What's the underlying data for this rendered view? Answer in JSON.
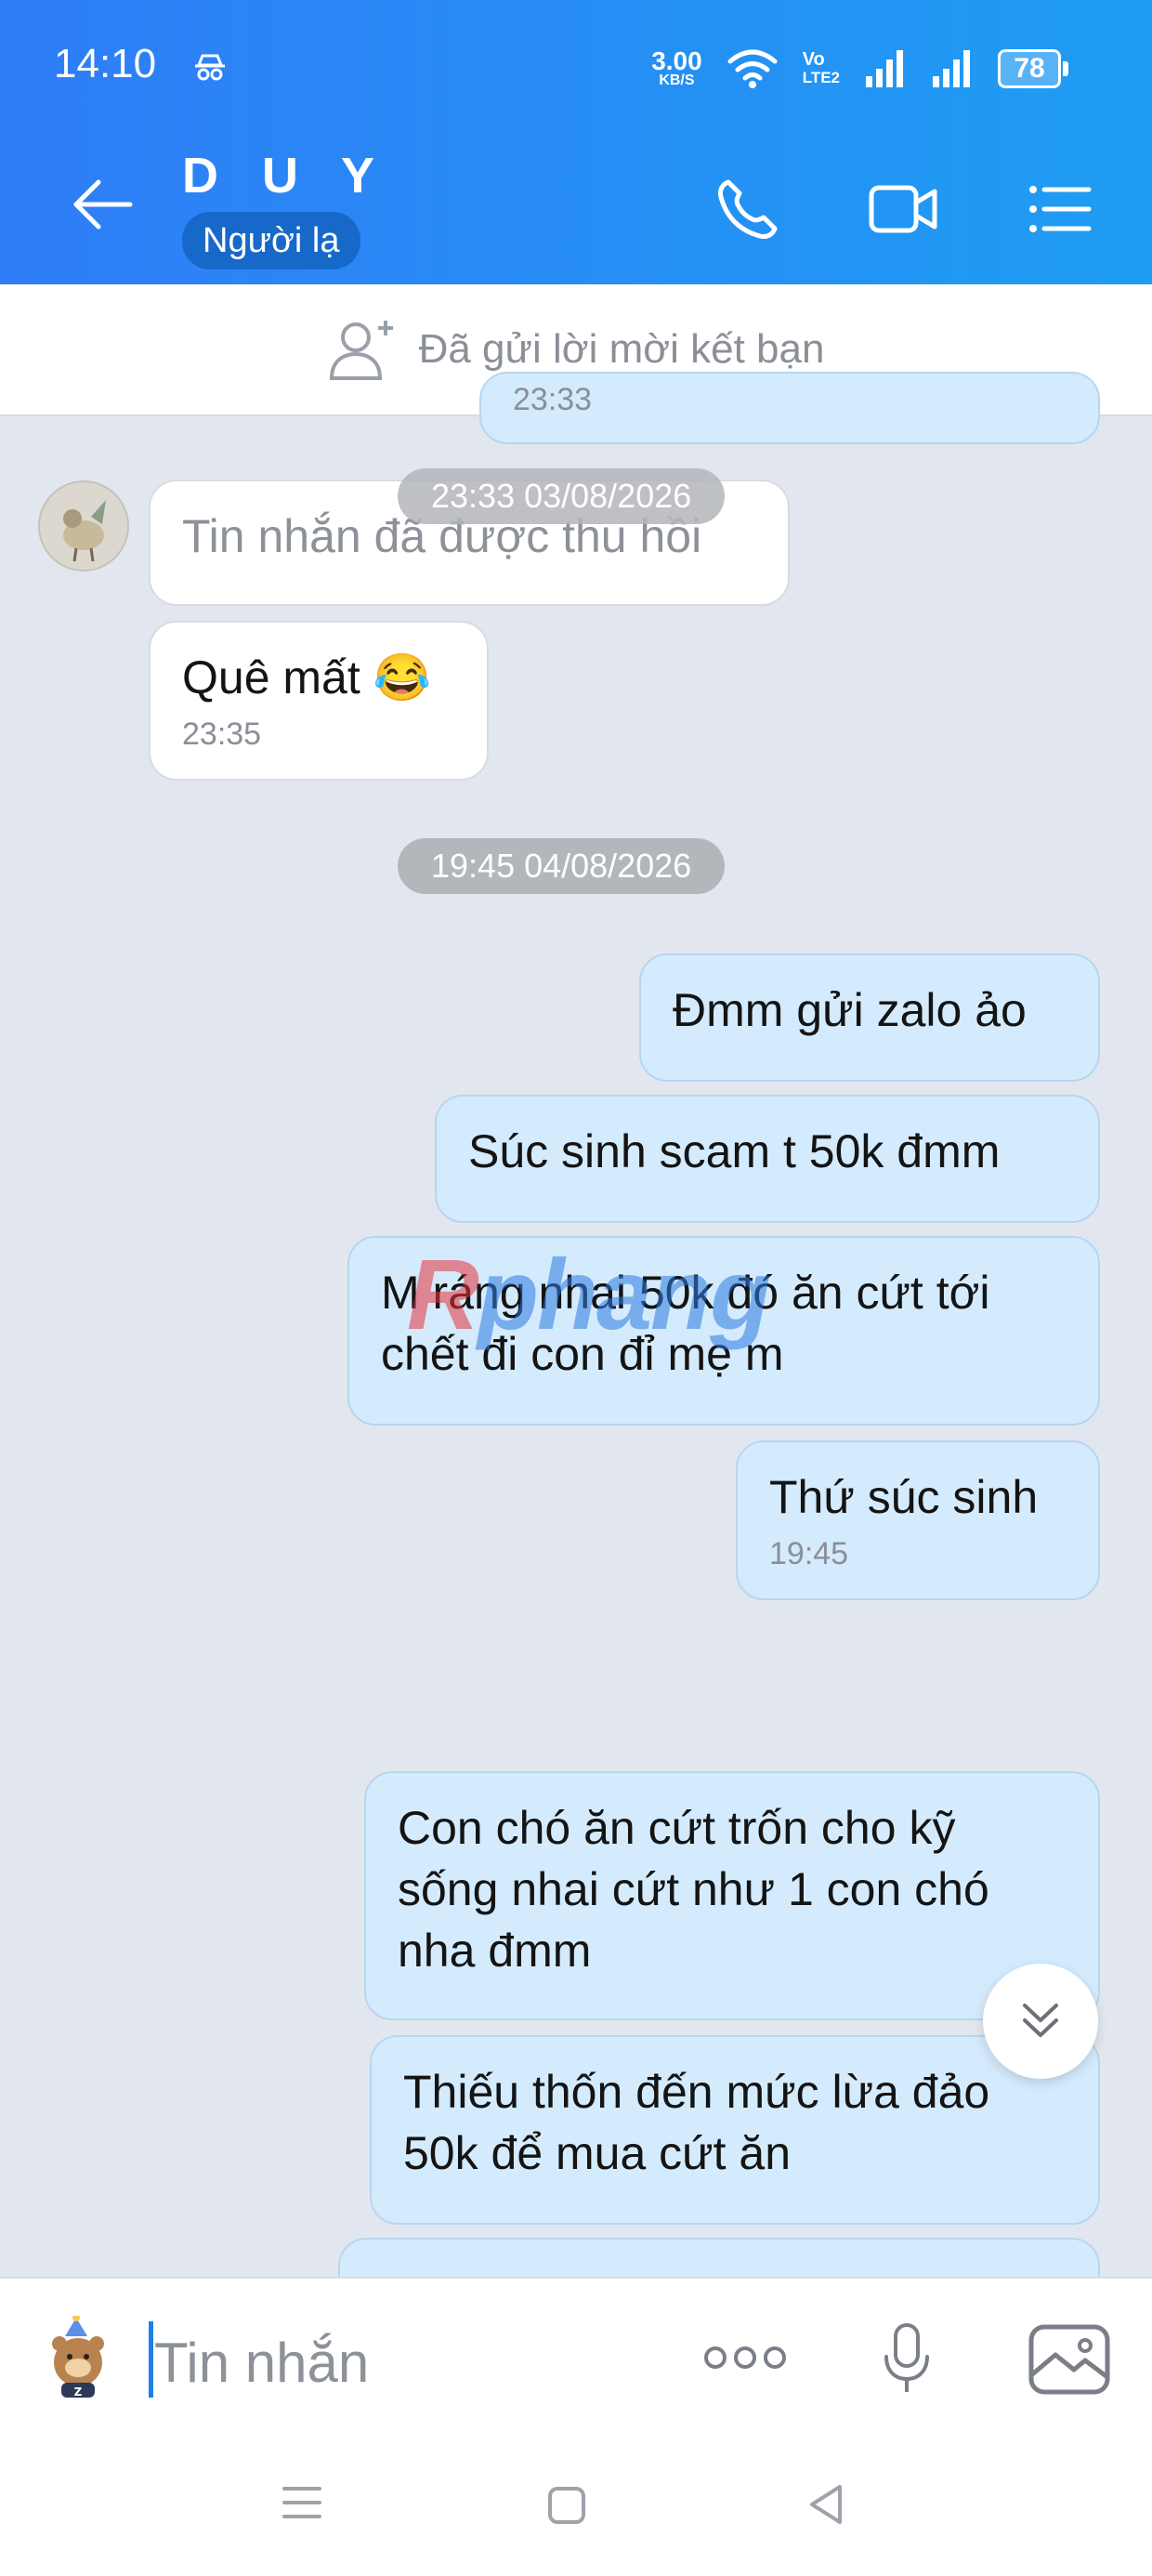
{
  "status_bar": {
    "time": "14:10",
    "net_speed_value": "3.00",
    "net_speed_unit": "KB/S",
    "volte_label": "Vo",
    "lte_label": "LTE2",
    "battery": "78"
  },
  "header": {
    "contact_name": "D U Y",
    "badge": "Người lạ"
  },
  "friend_request": {
    "text": "Đã gửi lời mời kết bạn"
  },
  "chat": {
    "partial_time_top": "23:33",
    "date_chip_1": "23:33 03/08/2026",
    "recalled_message": "Tin nhắn đã được thu hồi",
    "incoming_message": "Quê mất 😂",
    "incoming_time": "23:35",
    "date_chip_2": "19:45 04/08/2026",
    "out_1": "Đmm gửi zalo ảo",
    "out_2": "Súc sinh scam t 50k đmm",
    "out_3_line1": "M ráng nhai 50k đó ăn cứt tới",
    "out_3_line2": "chết đi con đỉ mẹ m",
    "out_4": "Thứ súc sinh",
    "out_4_time": "19:45",
    "out_5_line1": "Con chó ăn cứt trốn cho kỹ",
    "out_5_line2": "sống nhai cứt như 1 con chó",
    "out_5_line3": "nha đmm",
    "out_6_line1": "Thiếu thốn đến mức lừa đảo",
    "out_6_line2": "50k để mua cứt ăn"
  },
  "watermark": {
    "part1": "R",
    "part2": "phang"
  },
  "input": {
    "placeholder": "Tin nhắn"
  },
  "colors": {
    "header_start": "#2f7df6",
    "header_end": "#1e9df3",
    "outgoing_bubble": "#d4ebfd",
    "incoming_bubble": "#ffffff",
    "chat_background": "#e2e7ef"
  },
  "icons": {
    "incognito": "incognito-icon",
    "wifi": "wifi-icon",
    "signal": "signal-icon",
    "back": "back-arrow-icon",
    "call": "phone-icon",
    "video": "video-call-icon",
    "menu": "list-menu-icon",
    "add_friend": "add-user-icon",
    "scroll_down": "double-chevron-down-icon",
    "sticker": "sticker-icon",
    "more": "more-options-icon",
    "mic": "microphone-icon",
    "gallery": "image-icon",
    "nav_menu": "nav-recents-icon",
    "nav_home": "nav-home-icon",
    "nav_back": "nav-back-icon"
  }
}
